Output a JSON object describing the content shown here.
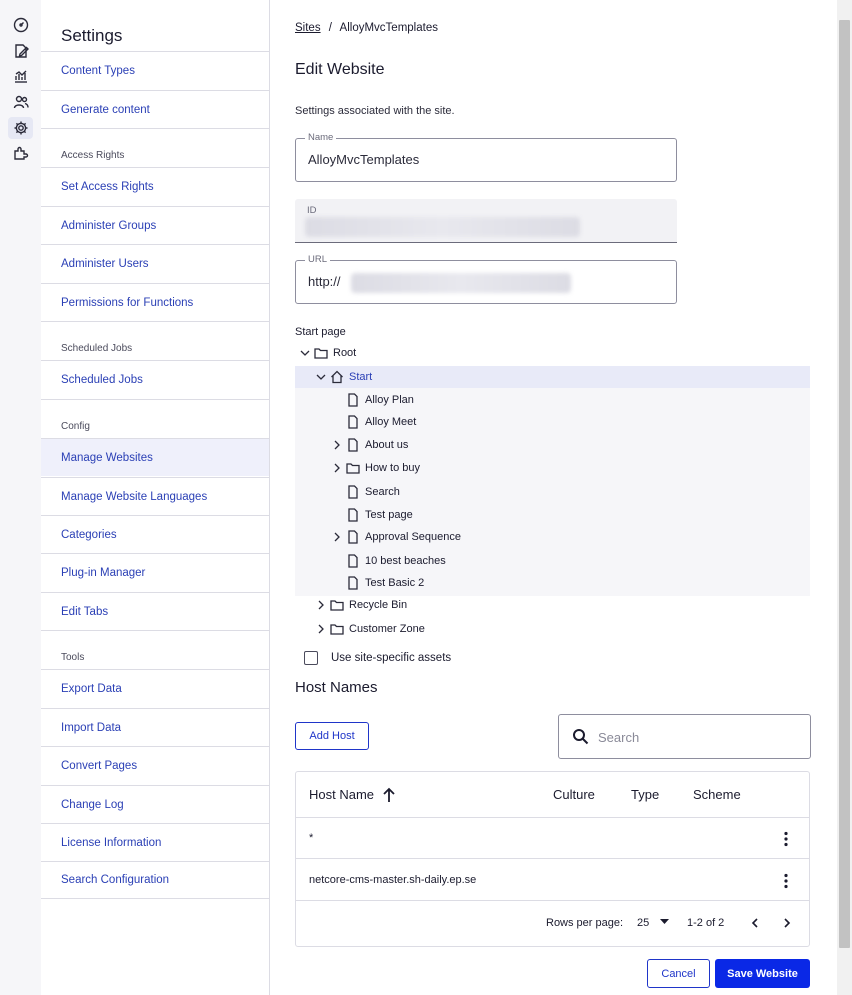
{
  "rail": {
    "icons": [
      "dashboard-icon",
      "edit-icon",
      "chart-icon",
      "users-icon",
      "settings-icon",
      "addons-icon"
    ]
  },
  "nav": {
    "title": "Settings",
    "items_top": [
      "Content Types",
      "Generate content"
    ],
    "section_access": "Access Rights",
    "items_access": [
      "Set Access Rights",
      "Administer Groups",
      "Administer Users",
      "Permissions for Functions"
    ],
    "section_jobs": "Scheduled Jobs",
    "items_jobs": [
      "Scheduled Jobs"
    ],
    "section_config": "Config",
    "items_config": [
      "Manage Websites",
      "Manage Website Languages",
      "Categories",
      "Plug-in Manager",
      "Edit Tabs"
    ],
    "section_tools": "Tools",
    "items_tools": [
      "Export Data",
      "Import Data",
      "Convert Pages",
      "Change Log",
      "License Information",
      "Search Configuration"
    ],
    "active": "Manage Websites"
  },
  "breadcrumb": {
    "root": "Sites",
    "separator": "/",
    "current": "AlloyMvcTemplates"
  },
  "page": {
    "title": "Edit Website",
    "subtitle": "Settings associated with the site."
  },
  "form": {
    "name_label": "Name",
    "name_value": "AlloyMvcTemplates",
    "id_label": "ID",
    "url_label": "URL",
    "url_prefix": "http://"
  },
  "start_page": {
    "label": "Start page",
    "tree": [
      {
        "label": "Root",
        "level": 0,
        "icon": "folder-icon",
        "chevron": "down"
      },
      {
        "label": "Start",
        "level": 1,
        "icon": "home-icon",
        "chevron": "down",
        "selected": true
      },
      {
        "label": "Alloy Plan",
        "level": 2,
        "icon": "page-icon",
        "chevron": "none"
      },
      {
        "label": "Alloy Meet",
        "level": 2,
        "icon": "page-icon",
        "chevron": "none"
      },
      {
        "label": "About us",
        "level": 2,
        "icon": "page-icon",
        "chevron": "right"
      },
      {
        "label": "How to buy",
        "level": 2,
        "icon": "folder-icon",
        "chevron": "right"
      },
      {
        "label": "Search",
        "level": 2,
        "icon": "page-icon",
        "chevron": "none"
      },
      {
        "label": "Test page",
        "level": 2,
        "icon": "page-icon",
        "chevron": "none"
      },
      {
        "label": "Approval Sequence",
        "level": 2,
        "icon": "page-icon",
        "chevron": "right"
      },
      {
        "label": "10 best beaches",
        "level": 2,
        "icon": "page-icon",
        "chevron": "none"
      },
      {
        "label": "Test Basic 2",
        "level": 2,
        "icon": "page-icon",
        "chevron": "none"
      },
      {
        "label": "Recycle Bin",
        "level": 1,
        "icon": "folder-icon",
        "chevron": "right"
      },
      {
        "label": "Customer Zone",
        "level": 1,
        "icon": "folder-icon",
        "chevron": "right"
      }
    ]
  },
  "site_assets_label": "Use site-specific assets",
  "hosts": {
    "title": "Host Names",
    "add_button": "Add Host",
    "search_placeholder": "Search",
    "columns": [
      "Host Name",
      "Culture",
      "Type",
      "Scheme"
    ],
    "rows": [
      {
        "host": "*"
      },
      {
        "host": "netcore-cms-master.sh-daily.ep.se"
      }
    ],
    "rows_per_page_label": "Rows per page:",
    "rows_per_page_value": "25",
    "range": "1-2 of 2"
  },
  "actions": {
    "cancel": "Cancel",
    "save": "Save Website"
  },
  "colors": {
    "accent": "#0a28e6",
    "link": "#2a3fb5",
    "active_bg": "#eff0fb"
  }
}
